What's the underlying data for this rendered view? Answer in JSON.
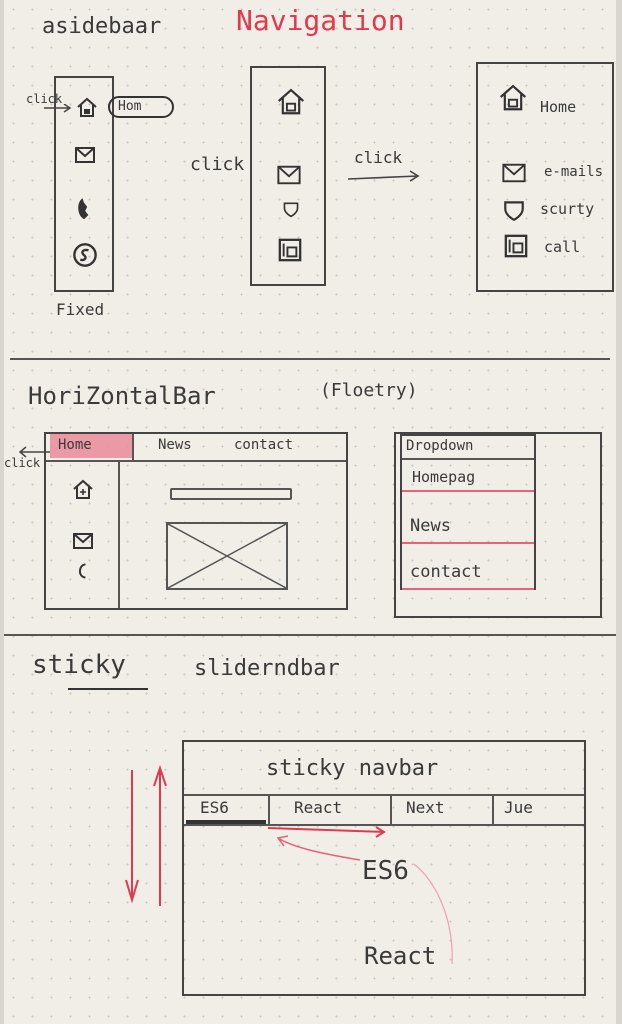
{
  "section1": {
    "title_left": "asidebaar",
    "title_right": "Navigation",
    "fixed_bar": {
      "click_label": "click",
      "tooltip": "Hom",
      "caption": "Fixed"
    },
    "middle_click": "click",
    "arrow_click": "click",
    "expanded_items": [
      "Home",
      "e-mails",
      "scurty",
      "call"
    ]
  },
  "section2": {
    "title": "HoriZontalBar",
    "title_paren": "(Floetry)",
    "click_label": "click",
    "tabs": [
      "Home",
      "News",
      "contact"
    ],
    "dropdown": {
      "header": "Dropdown",
      "items": [
        "Homepag",
        "News",
        "contact"
      ]
    }
  },
  "section3": {
    "title_a": "sticky",
    "title_b": "sliderndbar",
    "frame_title": "sticky navbar",
    "tabs": [
      "ES6",
      "React",
      "Next",
      "Jue"
    ],
    "content_1": "ES6",
    "content_2": "React"
  },
  "colors": {
    "accent_red": "#e03a4e",
    "ink": "#3a3a3a",
    "paper": "#f1eee8"
  }
}
